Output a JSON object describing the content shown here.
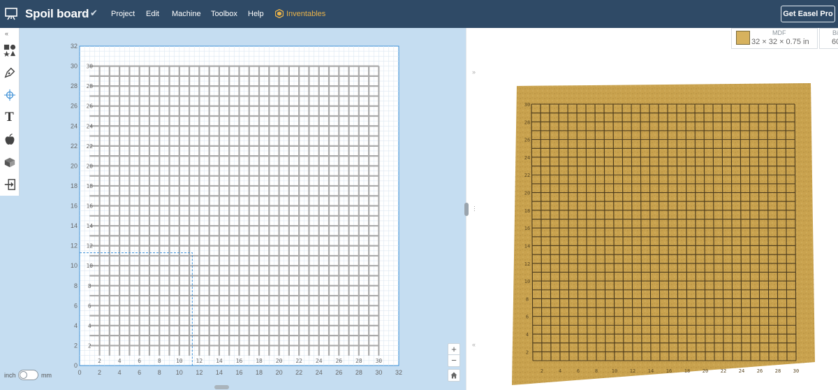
{
  "header": {
    "title": "Spoil board",
    "star_glyph": "☆",
    "check_glyph": "✔",
    "menu": [
      "Project",
      "Edit",
      "Machine",
      "Toolbox",
      "Help"
    ],
    "inventables": "Inventables",
    "cta": "Get Easel Pro"
  },
  "toolbar": {
    "collapse_glyph": "«",
    "items": [
      "shapes-icon",
      "pen-icon",
      "point-icon",
      "text-icon",
      "apps-icon",
      "box-icon",
      "import-icon"
    ],
    "text_glyph": "T"
  },
  "canvas": {
    "axis_labels": [
      "0",
      "2",
      "4",
      "6",
      "8",
      "10",
      "12",
      "14",
      "16",
      "18",
      "20",
      "22",
      "24",
      "26",
      "28",
      "30",
      "32"
    ],
    "grid_labels": [
      "2",
      "4",
      "6",
      "8",
      "10",
      "12",
      "14",
      "16",
      "18",
      "20",
      "22",
      "24",
      "26",
      "28",
      "30"
    ],
    "zoom_in": "+",
    "zoom_out": "−"
  },
  "units": {
    "inch": "inch",
    "mm": "mm"
  },
  "divider": {
    "expand_glyph": "»",
    "collapse_glyph": "«"
  },
  "material": {
    "name": "MDF",
    "dims": "32 × 32 × 0.75 in",
    "color": "#d7b25e"
  },
  "bit": {
    "label": "Bi",
    "value": "60"
  },
  "colors": {
    "header": "#2f4a66",
    "canvas": "#c5ddf1",
    "accent": "#e8b24a",
    "mdf": "#c9a24e"
  }
}
